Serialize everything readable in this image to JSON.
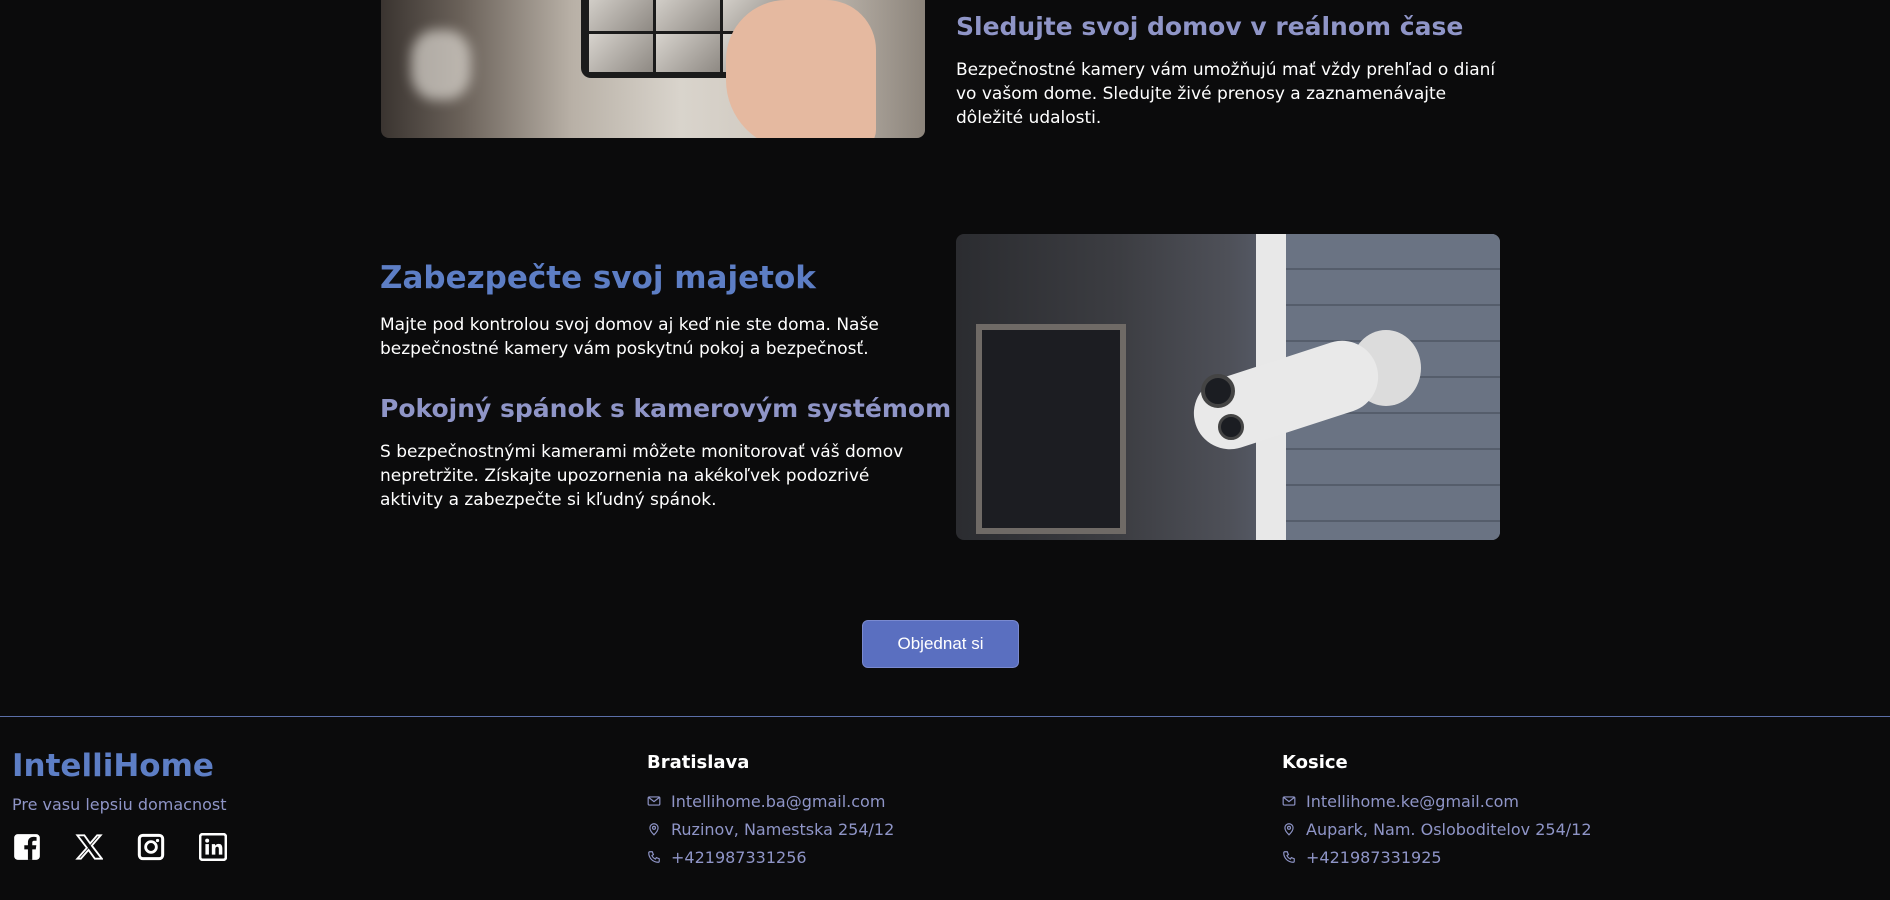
{
  "section_live": {
    "title": "Sledujte svoj domov v reálnom čase",
    "text": "Bezpečnostné kamery vám umožňujú mať vždy prehľad o dianí vo vašom dome. Sledujte živé prenosy a zaznamenávajte dôležité udalosti."
  },
  "section_secure": {
    "title": "Zabezpečte svoj majetok",
    "text": "Majte pod kontrolou svoj domov aj keď nie ste doma. Naše bezpečnostné kamery vám poskytnú pokoj a bezpečnosť."
  },
  "section_sleep": {
    "title": "Pokojný spánok s kamerovým systémom",
    "text": "S bezpečnostnými kamerami môžete monitorovať váš domov nepretržite. Získajte upozornenia na akékoľvek podozrivé aktivity a zabezpečte si kľudný spánok."
  },
  "cta": {
    "order_label": "Objednat si"
  },
  "footer": {
    "brand": "IntelliHome",
    "tagline": "Pre vasu lepsiu domacnost",
    "socials": [
      "facebook-icon",
      "x-icon",
      "instagram-icon",
      "linkedin-icon"
    ],
    "offices": [
      {
        "city": "Bratislava",
        "email": "Intellihome.ba@gmail.com",
        "address": "Ruzinov, Namestska 254/12",
        "phone": "+421987331256"
      },
      {
        "city": "Kosice",
        "email": "Intellihome.ke@gmail.com",
        "address": "Aupark, Nam. Osloboditelov 254/12",
        "phone": "+421987331925"
      }
    ]
  },
  "colors": {
    "accent": "#5d7ec5",
    "muted_accent": "#8f95c7",
    "button": "#5a6fc0",
    "background": "#0b0b0c"
  }
}
